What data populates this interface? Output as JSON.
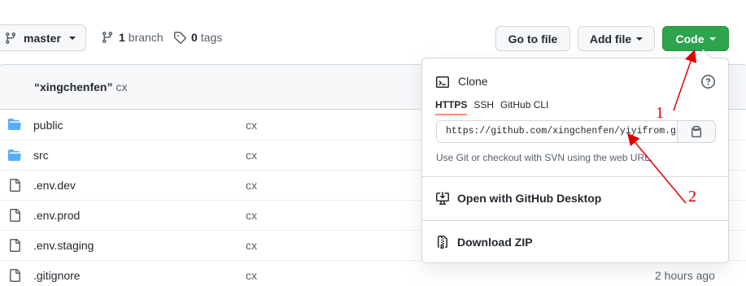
{
  "toolbar": {
    "branch_label": "master",
    "branch_count": "1",
    "branch_word": "branch",
    "tag_count": "0",
    "tag_word": "tags",
    "goto_file": "Go to file",
    "add_file": "Add file",
    "code": "Code"
  },
  "commit": {
    "message": "“xingchenfen”",
    "author": "cx"
  },
  "files": [
    {
      "name": "public",
      "type": "folder",
      "message": "cx",
      "time": ""
    },
    {
      "name": "src",
      "type": "folder",
      "message": "cx",
      "time": ""
    },
    {
      "name": ".env.dev",
      "type": "file",
      "message": "cx",
      "time": ""
    },
    {
      "name": ".env.prod",
      "type": "file",
      "message": "cx",
      "time": ""
    },
    {
      "name": ".env.staging",
      "type": "file",
      "message": "cx",
      "time": ""
    },
    {
      "name": ".gitignore",
      "type": "file",
      "message": "cx",
      "time": "2 hours ago"
    }
  ],
  "clone": {
    "title": "Clone",
    "tabs": [
      "HTTPS",
      "SSH",
      "GitHub CLI"
    ],
    "active_tab": "HTTPS",
    "url": "https://github.com/xingchenfen/yiyifrom.git",
    "note": "Use Git or checkout with SVN using the web URL.",
    "open_desktop": "Open with GitHub Desktop",
    "download_zip": "Download ZIP"
  },
  "annotations": {
    "label_1": "1",
    "label_2": "2",
    "color": "#e00000"
  },
  "colors": {
    "code_button": "#2da44e",
    "folder_icon": "#54aeff",
    "tab_underline": "#fd8c73"
  }
}
